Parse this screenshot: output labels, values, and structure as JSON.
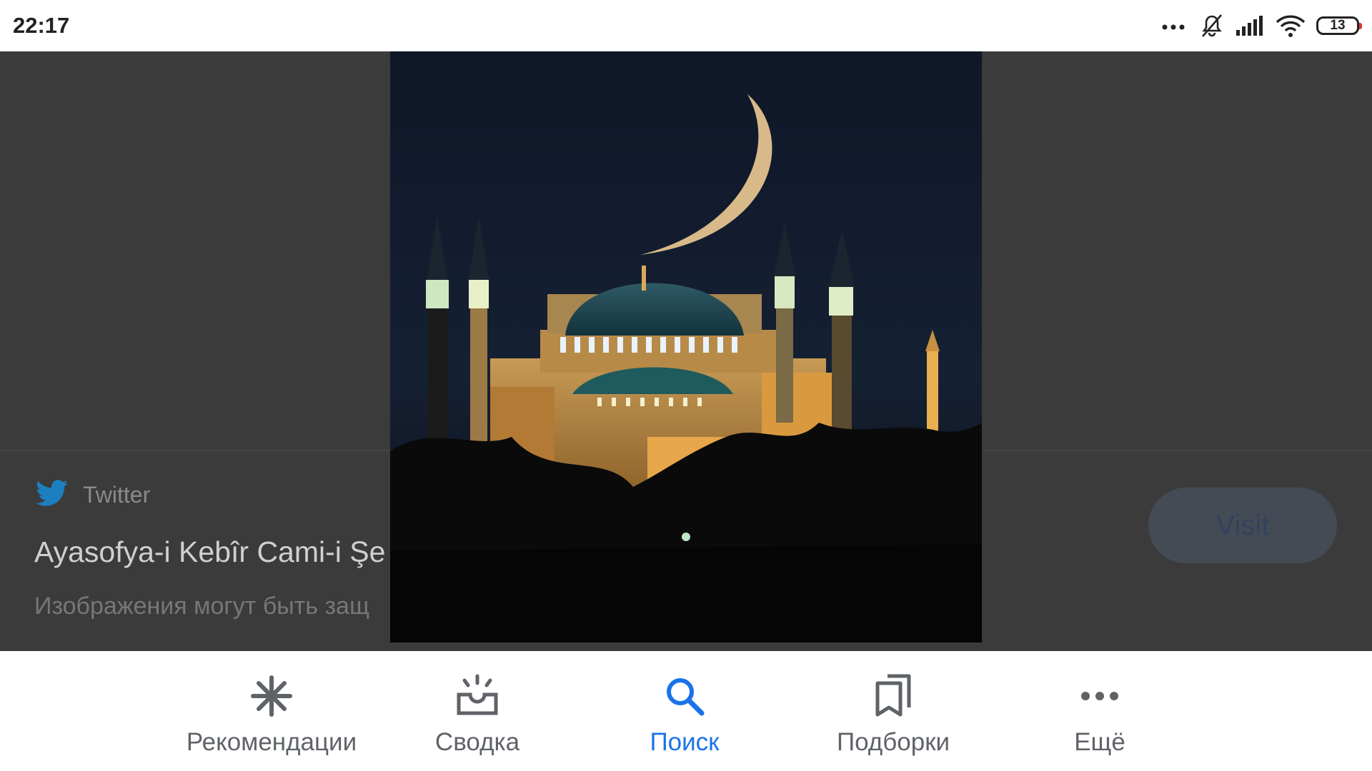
{
  "status_bar": {
    "time": "22:17",
    "battery": "13"
  },
  "result": {
    "source": "Twitter",
    "title": "Ayasofya-i Kebîr Cami-i Şe",
    "note": "Изображения могут быть защ",
    "visit_label": "Visit"
  },
  "bottom_nav": {
    "items": [
      {
        "label": "Рекомендации",
        "icon": "asterisk-icon"
      },
      {
        "label": "Сводка",
        "icon": "sunrise-inbox-icon"
      },
      {
        "label": "Поиск",
        "icon": "search-icon"
      },
      {
        "label": "Подборки",
        "icon": "bookmarks-icon"
      },
      {
        "label": "Ещё",
        "icon": "more-dots-icon"
      }
    ],
    "active": "Поиск"
  },
  "colors": {
    "accent": "#1a73e8",
    "twitter": "#1da1f2",
    "scrim": "#3b3b3b"
  }
}
